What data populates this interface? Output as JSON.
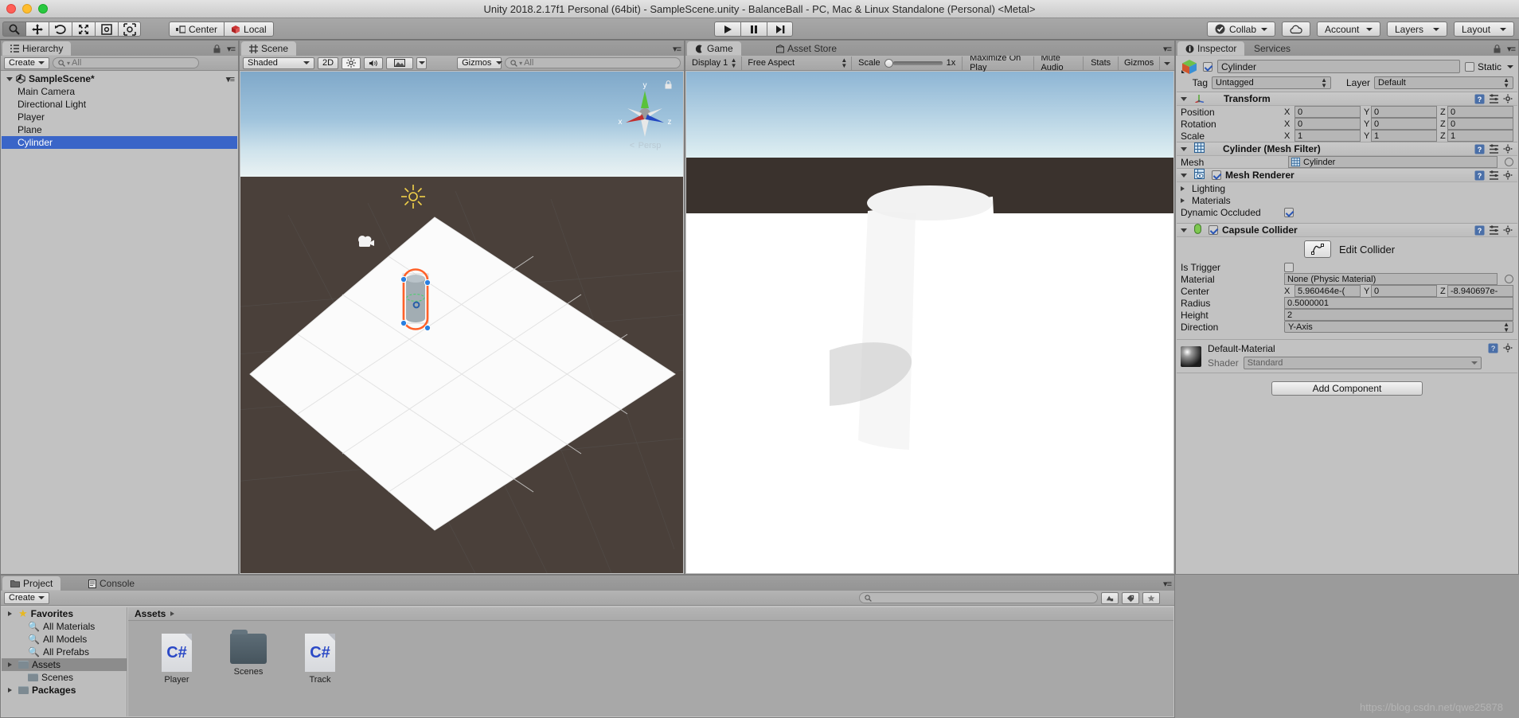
{
  "window": {
    "title": "Unity 2018.2.17f1 Personal (64bit) - SampleScene.unity - BalanceBall - PC, Mac & Linux Standalone (Personal) <Metal>"
  },
  "toolbar": {
    "tools": [
      {
        "name": "hand-tool",
        "icon": "search-hand"
      },
      {
        "name": "move-tool",
        "icon": "move"
      },
      {
        "name": "rotate-tool",
        "icon": "rotate"
      },
      {
        "name": "scale-tool",
        "icon": "scale"
      },
      {
        "name": "rect-tool",
        "icon": "rect"
      },
      {
        "name": "transform-tool",
        "icon": "transform"
      }
    ],
    "pivot_label": "Center",
    "space_label": "Local",
    "play_label": "Play",
    "pause_label": "Pause",
    "step_label": "Step",
    "collab_label": "Collab",
    "cloud_label": "Cloud",
    "account_label": "Account",
    "layers_label": "Layers",
    "layout_label": "Layout"
  },
  "hierarchy": {
    "tab_label": "Hierarchy",
    "create_label": "Create",
    "search_placeholder": "All",
    "scene_name": "SampleScene*",
    "items": [
      {
        "label": "Main Camera",
        "selected": false
      },
      {
        "label": "Directional Light",
        "selected": false
      },
      {
        "label": "Player",
        "selected": false
      },
      {
        "label": "Plane",
        "selected": false
      },
      {
        "label": "Cylinder",
        "selected": true
      }
    ]
  },
  "scene_view": {
    "tab_label": "Scene",
    "draw_mode": "Shaded",
    "mode_2d": "2D",
    "lighting_icon": "light-toggle-icon",
    "audio_icon": "audio-toggle-icon",
    "fx_icon": "effects-icon",
    "gizmos_label": "Gizmos",
    "search_placeholder": "All",
    "gizmo_axes": {
      "x": "x",
      "y": "y",
      "z": "z"
    },
    "projection_label": "Persp"
  },
  "game_view": {
    "tab_label": "Game",
    "asset_store_tab": "Asset Store",
    "display_label": "Display 1",
    "aspect_label": "Free Aspect",
    "scale_label": "Scale",
    "scale_value": "1x",
    "maximize_label": "Maximize On Play",
    "mute_label": "Mute Audio",
    "stats_label": "Stats",
    "gizmos_label": "Gizmos"
  },
  "inspector": {
    "tab_label": "Inspector",
    "services_tab": "Services",
    "object_name": "Cylinder",
    "object_enabled": true,
    "static_label": "Static",
    "tag_label": "Tag",
    "tag_value": "Untagged",
    "layer_label": "Layer",
    "layer_value": "Default",
    "components": [
      {
        "name": "transform",
        "title": "Transform",
        "rows": [
          {
            "label": "Position",
            "x": "0",
            "y": "0",
            "z": "0"
          },
          {
            "label": "Rotation",
            "x": "0",
            "y": "0",
            "z": "0"
          },
          {
            "label": "Scale",
            "x": "1",
            "y": "1",
            "z": "1"
          }
        ]
      },
      {
        "name": "mesh-filter",
        "title": "Cylinder (Mesh Filter)",
        "mesh_label": "Mesh",
        "mesh_value": "Cylinder"
      },
      {
        "name": "mesh-renderer",
        "title": "Mesh Renderer",
        "enabled": true,
        "lighting_label": "Lighting",
        "materials_label": "Materials",
        "dynamic_occluded_label": "Dynamic Occluded",
        "dynamic_occluded_value": true
      },
      {
        "name": "capsule-collider",
        "title": "Capsule Collider",
        "enabled": true,
        "edit_collider_label": "Edit Collider",
        "is_trigger_label": "Is Trigger",
        "is_trigger_value": false,
        "material_label": "Material",
        "material_value": "None (Physic Material)",
        "center_label": "Center",
        "center_x": "5.960464e-(",
        "center_y": "0",
        "center_z": "-8.940697e-",
        "radius_label": "Radius",
        "radius_value": "0.5000001",
        "height_label": "Height",
        "height_value": "2",
        "direction_label": "Direction",
        "direction_value": "Y-Axis"
      }
    ],
    "material": {
      "name": "Default-Material",
      "shader_label": "Shader",
      "shader_value": "Standard"
    },
    "add_component_label": "Add Component"
  },
  "project": {
    "tab_label": "Project",
    "console_tab": "Console",
    "create_label": "Create",
    "search_placeholder": "",
    "tree": [
      {
        "label": "Favorites",
        "type": "favorites",
        "bold": true,
        "indent": 0,
        "selected": false
      },
      {
        "label": "All Materials",
        "type": "search",
        "bold": false,
        "indent": 1,
        "selected": false
      },
      {
        "label": "All Models",
        "type": "search",
        "bold": false,
        "indent": 1,
        "selected": false
      },
      {
        "label": "All Prefabs",
        "type": "search",
        "bold": false,
        "indent": 1,
        "selected": false
      },
      {
        "label": "Assets",
        "type": "folder",
        "bold": false,
        "indent": 0,
        "selected": true
      },
      {
        "label": "Scenes",
        "type": "folder",
        "bold": false,
        "indent": 1,
        "selected": false
      },
      {
        "label": "Packages",
        "type": "folder",
        "bold": true,
        "indent": 0,
        "selected": false
      }
    ],
    "breadcrumb": "Assets",
    "assets": [
      {
        "label": "Player",
        "type": "csharp"
      },
      {
        "label": "Scenes",
        "type": "folder"
      },
      {
        "label": "Track",
        "type": "csharp"
      }
    ]
  },
  "watermark": "https://blog.csdn.net/qwe25878",
  "colors": {
    "selection_blue": "#3a65c8",
    "panel_gray": "#c2c2c2",
    "chrome_gray": "#9b9b9b",
    "collider_green": "#50e070",
    "gizmo_orange": "#ff5a1f"
  }
}
